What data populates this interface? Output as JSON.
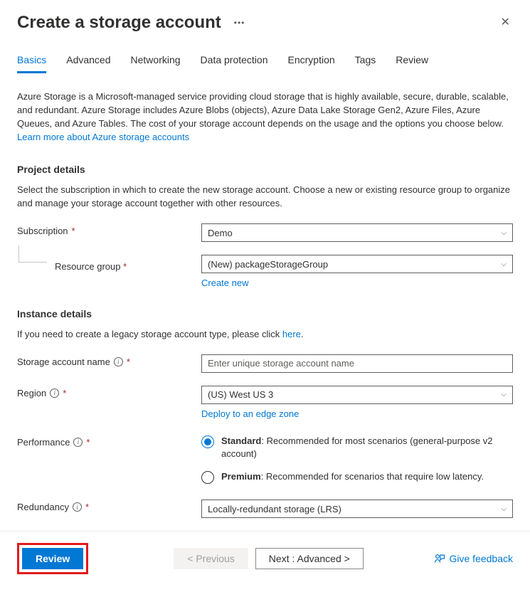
{
  "header": {
    "title": "Create a storage account"
  },
  "tabs": [
    {
      "id": "basics",
      "label": "Basics",
      "active": true
    },
    {
      "id": "advanced",
      "label": "Advanced",
      "active": false
    },
    {
      "id": "networking",
      "label": "Networking",
      "active": false
    },
    {
      "id": "data-protection",
      "label": "Data protection",
      "active": false
    },
    {
      "id": "encryption",
      "label": "Encryption",
      "active": false
    },
    {
      "id": "tags",
      "label": "Tags",
      "active": false
    },
    {
      "id": "review",
      "label": "Review",
      "active": false
    }
  ],
  "intro": {
    "text": "Azure Storage is a Microsoft-managed service providing cloud storage that is highly available, secure, durable, scalable, and redundant. Azure Storage includes Azure Blobs (objects), Azure Data Lake Storage Gen2, Azure Files, Azure Queues, and Azure Tables. The cost of your storage account depends on the usage and the options you choose below. ",
    "link": "Learn more about Azure storage accounts"
  },
  "project": {
    "title": "Project details",
    "desc": "Select the subscription in which to create the new storage account. Choose a new or existing resource group to organize and manage your storage account together with other resources.",
    "subscription_label": "Subscription",
    "subscription_value": "Demo",
    "resource_group_label": "Resource group",
    "resource_group_value": "(New) packageStorageGroup",
    "create_new": "Create new"
  },
  "instance": {
    "title": "Instance details",
    "legacy_text": "If you need to create a legacy storage account type, please click ",
    "legacy_link": "here",
    "name_label": "Storage account name",
    "name_placeholder": "Enter unique storage account name",
    "region_label": "Region",
    "region_value": "(US) West US 3",
    "deploy_edge": "Deploy to an edge zone",
    "performance_label": "Performance",
    "performance_options": [
      {
        "id": "standard",
        "name": "Standard",
        "desc": ": Recommended for most scenarios (general-purpose v2 account)",
        "selected": true
      },
      {
        "id": "premium",
        "name": "Premium",
        "desc": ": Recommended for scenarios that require low latency.",
        "selected": false
      }
    ],
    "redundancy_label": "Redundancy",
    "redundancy_value": "Locally-redundant storage (LRS)"
  },
  "footer": {
    "review": "Review",
    "previous": "< Previous",
    "next": "Next : Advanced >",
    "feedback": "Give feedback"
  }
}
